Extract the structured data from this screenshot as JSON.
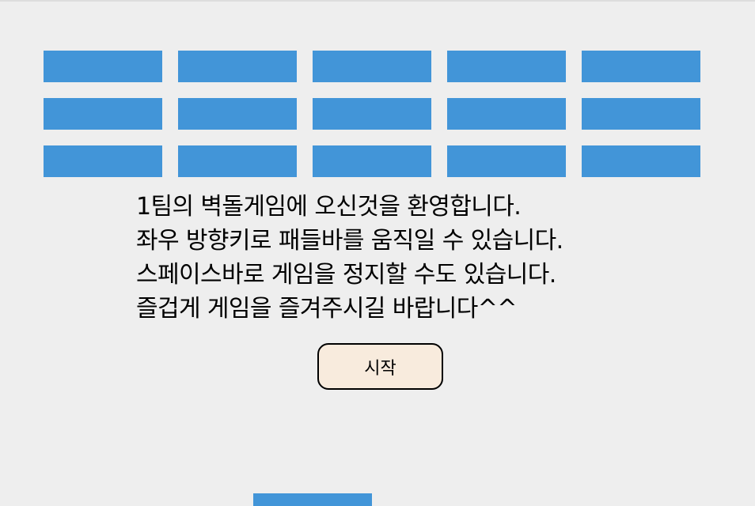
{
  "game": {
    "brick_rows": 3,
    "brick_columns": 5,
    "brick_color": "#4295d8",
    "background_color": "#eeeeee",
    "paddle_color": "#4295d8"
  },
  "intro": {
    "lines": [
      "1팀의 벽돌게임에 오신것을 환영합니다.",
      "좌우 방향키로 패들바를 움직일 수 있습니다.",
      "스페이스바로 게임을 정지할 수도 있습니다.",
      "즐겁게 게임을 즐겨주시길 바랍니다^^"
    ]
  },
  "start_button": {
    "label": "시작",
    "background_color": "#f8ebdd",
    "border_color": "#000000"
  }
}
